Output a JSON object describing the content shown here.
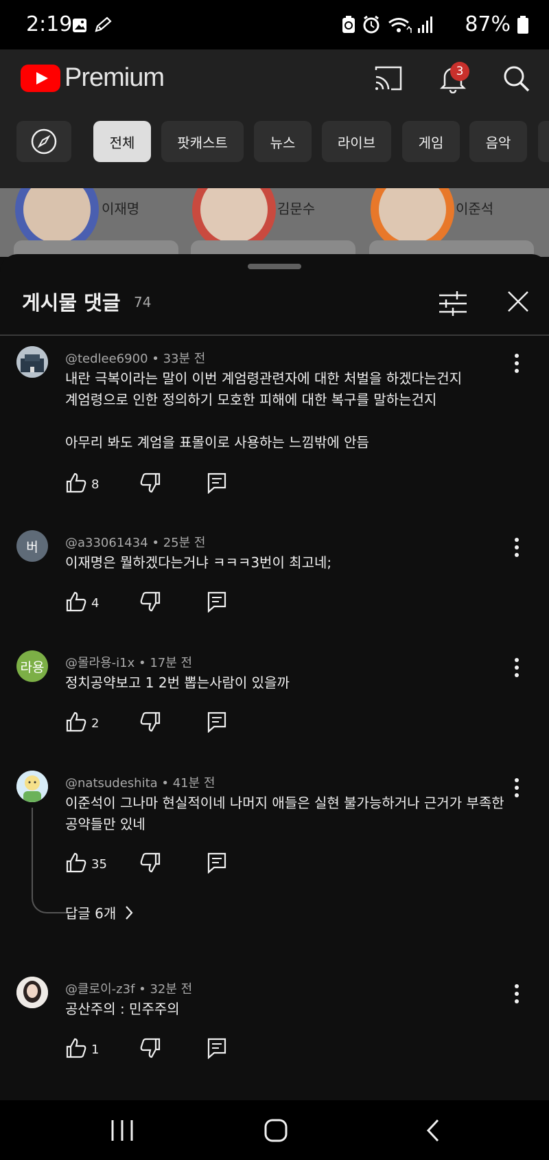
{
  "status_bar": {
    "time": "2:19",
    "battery": "87%"
  },
  "app_bar": {
    "brand": "Premium",
    "notification_count": "3"
  },
  "chips": [
    "전체",
    "팟캐스트",
    "뉴스",
    "라이브",
    "게임",
    "음악"
  ],
  "background_post": {
    "candidates": [
      "이재명",
      "김문수",
      "이준석"
    ]
  },
  "sheet": {
    "title": "게시물 댓글",
    "count": "74"
  },
  "comments": [
    {
      "author": "@tedlee6900",
      "time": "33분 전",
      "text": "내란 극복이라는 말이 이번 계엄령관련자에 대한 처벌을 하겠다는건지\n계엄령으로 인한 정의하기 모호한 피해에 대한 복구를 말하는건지\n\n아무리 봐도 계엄을 표몰이로 사용하는 느낌밖에 안듬",
      "likes": "8"
    },
    {
      "author": "@a33061434",
      "avatar_text": "버",
      "time": "25분 전",
      "text": "이재명은 뭘하겠다는거냐 ㅋㅋㅋ3번이 최고네;",
      "likes": "4"
    },
    {
      "author": "@몰라용-i1x",
      "avatar_text": "라용",
      "time": "17분 전",
      "text": "정치공약보고 1 2번 뽑는사람이 있을까",
      "likes": "2"
    },
    {
      "author": "@natsudeshita",
      "time": "41분 전",
      "text": "이준석이 그나마 현실적이네 나머지 애들은 실현 불가능하거나 근거가 부족한\n공약들만 있네",
      "likes": "35",
      "replies": "답글 6개"
    },
    {
      "author": "@클로이-z3f",
      "time": "32분 전",
      "text": "공산주의 : 민주주의",
      "likes": "1"
    }
  ],
  "colors": {
    "background": "#0f0f0f",
    "surface": "#212121",
    "chip": "#2f2f2f",
    "chip_active": "#dedede",
    "text": "#f1f1f1",
    "secondary_text": "#aaaaaa",
    "brand_red": "#ff0000",
    "badge": "#c9302c"
  },
  "icons": [
    "gallery-icon",
    "pen-icon",
    "battery-saver-icon",
    "alarm-icon",
    "wifi-icon",
    "signal-icon",
    "battery-icon",
    "youtube-logo-icon",
    "cast-icon",
    "bell-icon",
    "search-icon",
    "compass-icon",
    "filter-icon",
    "close-icon",
    "thumbs-up-icon",
    "thumbs-down-icon",
    "reply-icon",
    "more-vert-icon",
    "chevron-right-icon",
    "recents-icon",
    "home-icon",
    "back-icon"
  ]
}
